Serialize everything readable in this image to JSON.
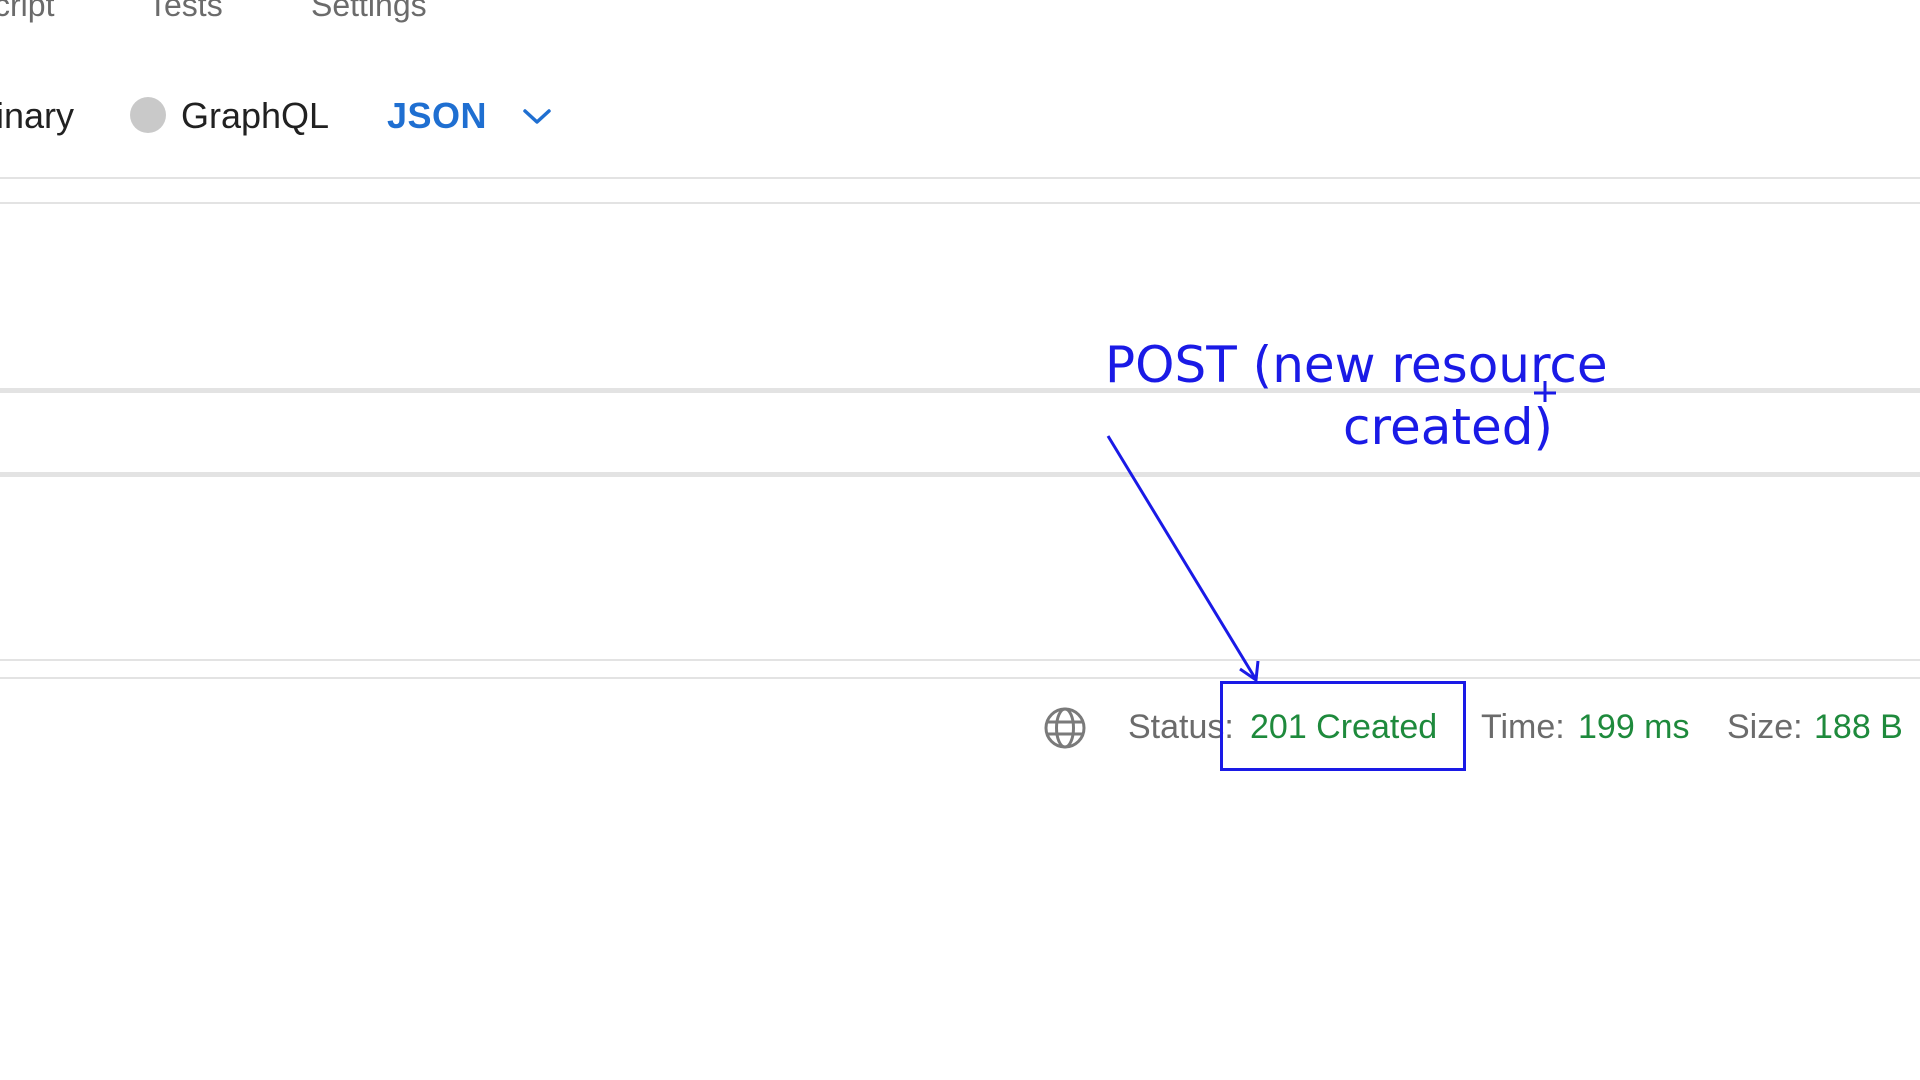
{
  "tabs": {
    "script": "cript",
    "tests": "Tests",
    "settings": "Settings"
  },
  "body_types": {
    "binary": "inary",
    "graphql": "GraphQL",
    "format": "JSON",
    "format_dropdown_icon": "chevron-down-icon"
  },
  "response": {
    "status_label": "Status:",
    "status_value": "201 Created",
    "time_label": "Time:",
    "time_value": "199 ms",
    "size_label": "Size:",
    "size_value": "188 B",
    "network_icon": "globe-icon"
  },
  "annotation": {
    "line1": "POST (new resource",
    "line2": "created)",
    "color": "#1a1ae6"
  },
  "colors": {
    "accent": "#1f6fd1",
    "success": "#1e8a3c",
    "muted_text": "#6b6b6b"
  }
}
